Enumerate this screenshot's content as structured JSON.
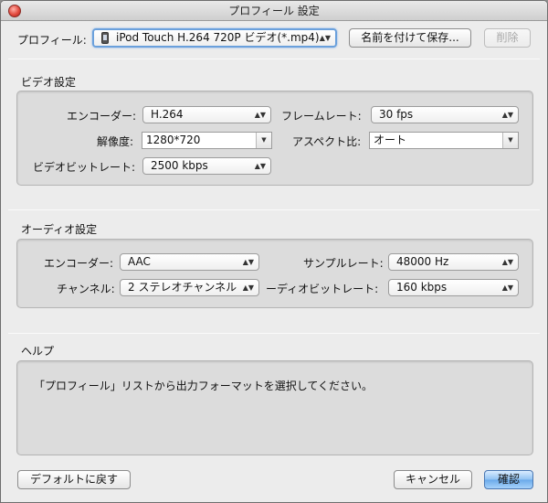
{
  "window": {
    "title": "プロフィール 設定"
  },
  "profile": {
    "label": "プロフィール:",
    "value": "iPod Touch H.264 720P ビデオ(*.mp4)",
    "icon": "ipod-touch-icon",
    "save_as_label": "名前を付けて保存...",
    "delete_label": "削除"
  },
  "video": {
    "section_title": "ビデオ設定",
    "encoder_label": "エンコーダー:",
    "encoder_value": "H.264",
    "framerate_label": "フレームレート:",
    "framerate_value": "30 fps",
    "resolution_label": "解像度:",
    "resolution_value": "1280*720",
    "aspect_label": "アスペクト比:",
    "aspect_value": "オート",
    "bitrate_label": "ビデオビットレート:",
    "bitrate_value": "2500 kbps"
  },
  "audio": {
    "section_title": "オーディオ設定",
    "encoder_label": "エンコーダー:",
    "encoder_value": "AAC",
    "samplerate_label": "サンプルレート:",
    "samplerate_value": "48000 Hz",
    "channel_label": "チャンネル:",
    "channel_value": "2 ステレオチャンネル",
    "bitrate_label": "ーディオビットレート:",
    "bitrate_value": "160 kbps"
  },
  "help": {
    "section_title": "ヘルプ",
    "text": "「プロフィール」リストから出力フォーマットを選択してください。"
  },
  "footer": {
    "default_label": "デフォルトに戻す",
    "cancel_label": "キャンセル",
    "ok_label": "確認"
  }
}
